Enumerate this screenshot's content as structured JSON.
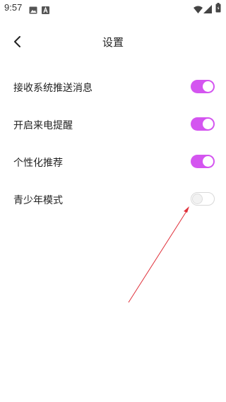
{
  "status_bar": {
    "time": "9:57",
    "icons": [
      "image-icon",
      "a-icon",
      "wifi-icon",
      "signal-icon",
      "battery-icon"
    ]
  },
  "header": {
    "title": "设置",
    "back_icon": "chevron-left-icon"
  },
  "settings": [
    {
      "label": "接收系统推送消息",
      "enabled": true
    },
    {
      "label": "开启来电提醒",
      "enabled": true
    },
    {
      "label": "个性化推荐",
      "enabled": true
    },
    {
      "label": "青少年模式",
      "enabled": false
    }
  ],
  "colors": {
    "toggle_on": "#d455f0",
    "toggle_off_border": "#d8d8d8",
    "annotation_arrow": "#e0303a"
  }
}
